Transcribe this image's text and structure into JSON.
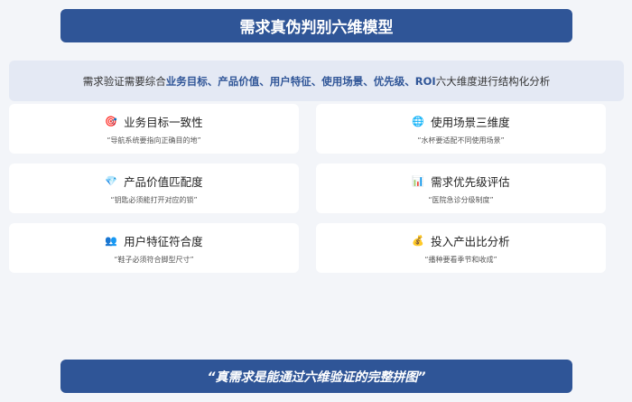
{
  "title": "需求真伪判别六维模型",
  "intro": {
    "prefix": "需求验证需要综合 ",
    "highlight": "业务目标、产品价值、用户特征、使用场景、优先级、ROI",
    "suffix": " 六大维度进行结构化分析"
  },
  "cards": [
    {
      "icon": "🎯",
      "icon_name": "target-icon",
      "title": "业务目标一致性",
      "desc": "“导航系统要指向正确目的地”"
    },
    {
      "icon": "🌐",
      "icon_name": "globe-icon",
      "title": "使用场景三维度",
      "desc": "“水杯要适配不同使用场景”"
    },
    {
      "icon": "💎",
      "icon_name": "gem-icon",
      "title": "产品价值匹配度",
      "desc": "“钥匙必须能打开对应的锁”"
    },
    {
      "icon": "📊",
      "icon_name": "bar-chart-icon",
      "title": "需求优先级评估",
      "desc": "“医院急诊分级制度”"
    },
    {
      "icon": "👥",
      "icon_name": "users-icon",
      "title": "用户特征符合度",
      "desc": "“鞋子必须符合脚型尺寸”"
    },
    {
      "icon": "💰",
      "icon_name": "money-bag-icon",
      "title": "投入产出比分析",
      "desc": "“播种要看季节和收成”"
    }
  ],
  "footer": "“真需求是能通过六维验证的完整拼图”",
  "colors": {
    "accent": "#2f5597",
    "background": "#f3f5f9",
    "intro_bg": "#e4e9f4",
    "card_bg": "#ffffff"
  }
}
